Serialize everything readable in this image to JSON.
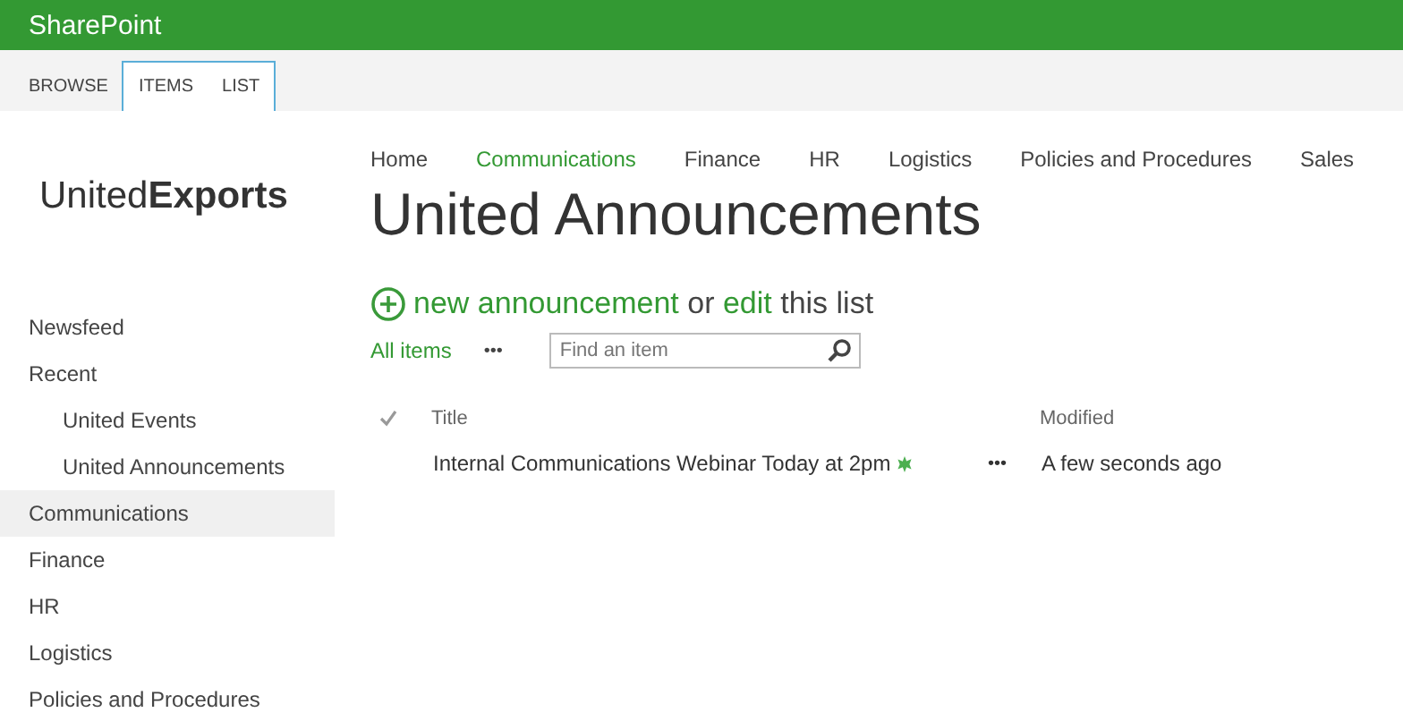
{
  "suite_bar": {
    "title": "SharePoint"
  },
  "ribbon_tabs": [
    {
      "label": "BROWSE",
      "selected": false
    },
    {
      "label": "ITEMS",
      "selected": true
    },
    {
      "label": "LIST",
      "selected": true
    }
  ],
  "logo": "United**Exports**",
  "sidebar": {
    "items": [
      {
        "label": "Newsfeed",
        "selected": false
      },
      {
        "label": "Recent",
        "selected": false,
        "children": [
          {
            "label": "United Events",
            "selected": false
          },
          {
            "label": "United Announcements",
            "selected": false
          }
        ]
      },
      {
        "label": "Communications",
        "selected": true
      },
      {
        "label": "Finance",
        "selected": false
      },
      {
        "label": "HR",
        "selected": false
      },
      {
        "label": "Logistics",
        "selected": false
      },
      {
        "label": "Policies and Procedures",
        "selected": false
      }
    ]
  },
  "top_nav": [
    {
      "label": "Home",
      "selected": false
    },
    {
      "label": "Communications",
      "selected": true
    },
    {
      "label": "Finance",
      "selected": false
    },
    {
      "label": "HR",
      "selected": false
    },
    {
      "label": "Logistics",
      "selected": false
    },
    {
      "label": "Policies and Procedures",
      "selected": false
    },
    {
      "label": "Sales",
      "selected": false
    }
  ],
  "page_title": "United Announcements",
  "actions": {
    "new_link": "new announcement",
    "joiner": "or",
    "edit_link": "edit",
    "tail": "this list"
  },
  "views": {
    "current": "All items",
    "more": "•••",
    "search": {
      "placeholder": "Find an item"
    }
  },
  "table": {
    "columns": [
      "Title",
      "Modified"
    ],
    "rows": [
      {
        "title": "Internal Communications Webinar Today at 2pm",
        "new": true,
        "menu": "•••",
        "modified": "A few seconds ago"
      }
    ]
  }
}
